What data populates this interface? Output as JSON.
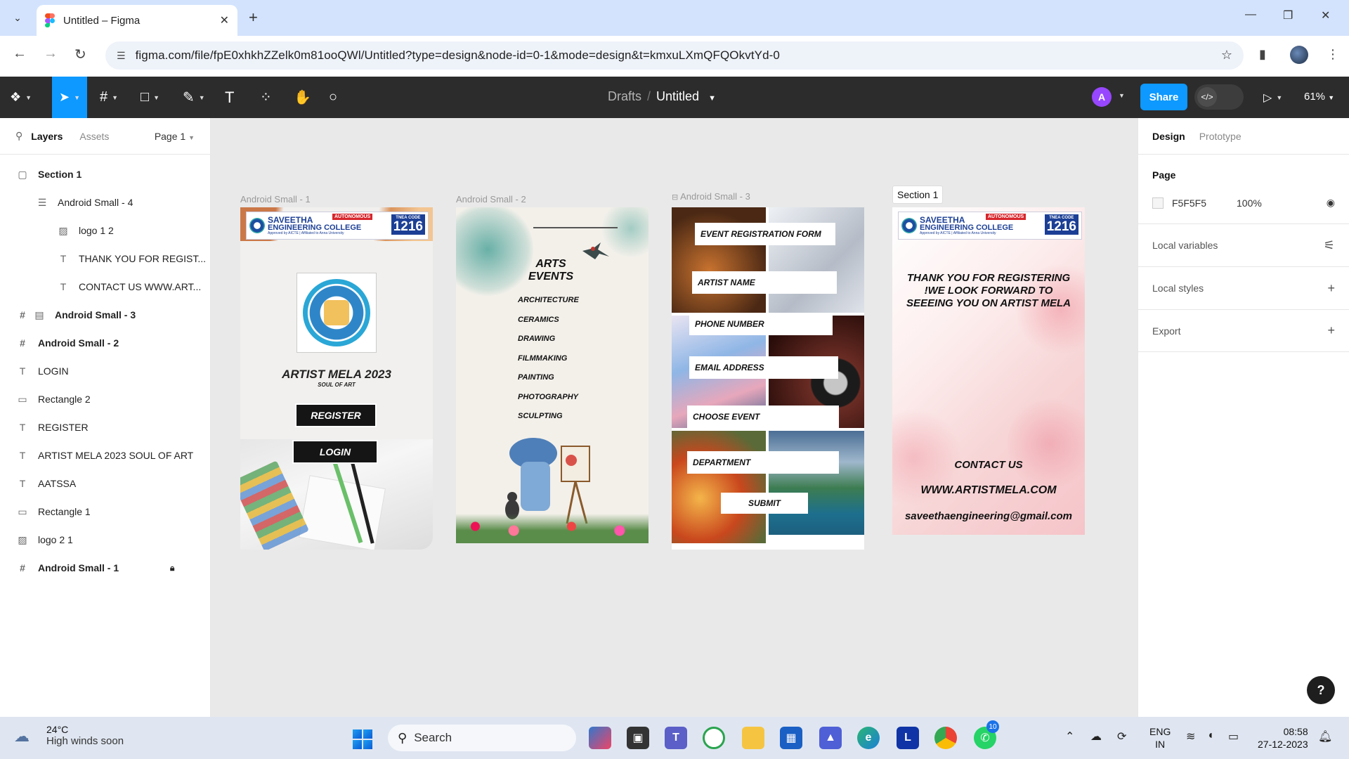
{
  "browser": {
    "tab_title": "Untitled – Figma",
    "url": "figma.com/file/fpE0xhkhZZelk0m81ooQWl/Untitled?type=design&node-id=0-1&mode=design&t=kmxuLXmQFQOkvtYd-0"
  },
  "figma": {
    "breadcrumb_parent": "Drafts",
    "breadcrumb_sep": "/",
    "file_name": "Untitled",
    "avatar_initial": "A",
    "share_label": "Share",
    "zoom": "61%"
  },
  "left_panel": {
    "tab_layers": "Layers",
    "tab_assets": "Assets",
    "page_label": "Page 1",
    "layers": [
      {
        "name": "Section 1",
        "icon": "section-icon"
      },
      {
        "name": "Android Small - 4",
        "icon": "frame-list-icon"
      },
      {
        "name": "logo 1 2",
        "icon": "image-icon"
      },
      {
        "name": "THANK YOU FOR REGIST...",
        "icon": "text-icon"
      },
      {
        "name": "CONTACT US WWW.ART...",
        "icon": "text-icon"
      },
      {
        "name": "Android Small - 3",
        "icon": "frame-icon"
      },
      {
        "name": "Android Small - 2",
        "icon": "frame-icon"
      },
      {
        "name": "LOGIN",
        "icon": "text-icon"
      },
      {
        "name": "Rectangle 2",
        "icon": "rectangle-icon"
      },
      {
        "name": "REGISTER",
        "icon": "text-icon"
      },
      {
        "name": "ARTIST MELA 2023 SOUL OF ART",
        "icon": "text-icon"
      },
      {
        "name": "AATSSA",
        "icon": "text-icon"
      },
      {
        "name": "Rectangle 1",
        "icon": "rectangle-icon"
      },
      {
        "name": "logo 2 1",
        "icon": "image-icon"
      },
      {
        "name": "Android Small - 1",
        "icon": "frame-icon"
      }
    ]
  },
  "right_panel": {
    "tab_design": "Design",
    "tab_prototype": "Prototype",
    "page_title": "Page",
    "page_color": "F5F5F5",
    "page_opacity": "100%",
    "local_variables": "Local variables",
    "local_styles": "Local styles",
    "export": "Export",
    "help": "?"
  },
  "canvas": {
    "frame1_label": "Android Small - 1",
    "frame2_label": "Android Small - 2",
    "frame3_label": "Android Small - 3",
    "section_label": "Section 1",
    "college": {
      "name1": "SAVEETHA",
      "name2": "ENGINEERING COLLEGE",
      "autonomous": "AUTONOMOUS",
      "approval": "Approved by AICTE | Affiliated to Anna University",
      "tnea_label": "TNEA CODE",
      "tnea_code": "1216"
    },
    "frame1": {
      "title": "ARTIST MELA  2023",
      "subtitle": "SOUL OF ART",
      "register": "REGISTER",
      "login": "LOGIN"
    },
    "frame2": {
      "title": "ARTS EVENTS",
      "events": [
        "ARCHITECTURE",
        "CERAMICS",
        "DRAWING",
        "FILMMAKING",
        "PAINTING",
        "PHOTOGRAPHY",
        "SCULPTING"
      ]
    },
    "frame3": {
      "form_title": "EVENT REGISTRATION FORM",
      "fields": [
        "ARTIST NAME",
        "PHONE NUMBER",
        "EMAIL ADDRESS",
        "CHOOSE EVENT",
        "DEPARTMENT"
      ],
      "submit": "SUBMIT"
    },
    "frame4": {
      "thanks": "THANK YOU FOR REGISTERING !WE LOOK FORWARD TO SEEEING YOU ON ARTIST MELA",
      "contact": "CONTACT US",
      "website": "WWW.ARTISTMELA.COM",
      "email": "saveethaengineering@gmail.com"
    }
  },
  "taskbar": {
    "temp": "24°C",
    "weather": "High winds soon",
    "search": "Search",
    "whatsapp_badge": "10",
    "lang1": "ENG",
    "lang2": "IN",
    "time": "08:58",
    "date": "27-12-2023"
  },
  "colors": {
    "figma_toolbar": "#2c2c2c",
    "accent": "#0d99ff",
    "avatar": "#9747ff"
  }
}
